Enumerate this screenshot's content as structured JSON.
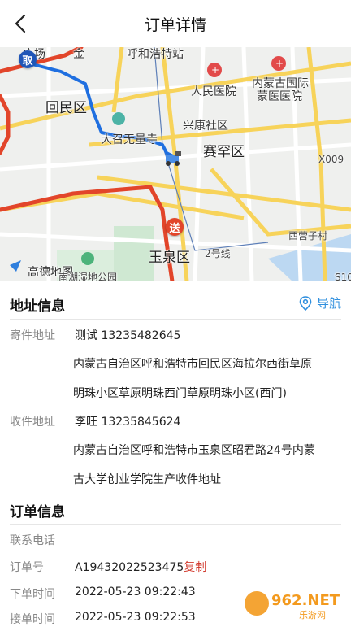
{
  "header": {
    "title": "订单详情"
  },
  "map": {
    "labels": {
      "plaza": "广场",
      "jin": "金",
      "station": "呼和浩特站",
      "hospital1": "人民医院",
      "hospital2a": "内蒙古国际",
      "hospital2b": "蒙医医院",
      "huimin": "回民区",
      "xingkang": "兴康社区",
      "temple": "大召无量寺",
      "saihan": "赛罕区",
      "x009": "X009",
      "xiying": "西营子村",
      "yuquan": "玉泉区",
      "line2": "2号线",
      "gaode": "高德地图",
      "park": "南湖湿地公园",
      "s10": "S10"
    },
    "pickup_badge": "取",
    "delivery_badge": "送",
    "route_color": "#1f6fe0",
    "road_red": "#e2452a"
  },
  "address_section": {
    "title": "地址信息",
    "nav_label": "导航",
    "sender_label": "寄件地址",
    "sender_contact": "测试 13235482645",
    "sender_address_line1": "内蒙古自治区呼和浩特市回民区海拉尔西街草原",
    "sender_address_line2": "明珠小区草原明珠西门草原明珠小区(西门)",
    "receiver_label": "收件地址",
    "receiver_contact": "李旺 13235845624",
    "receiver_address_line1": "内蒙古自治区呼和浩特市玉泉区昭君路24号内蒙",
    "receiver_address_line2": "古大学创业学院生产收件地址"
  },
  "order_section": {
    "title": "订单信息",
    "phone_label": "联系电话",
    "phone_value": "",
    "order_no_label": "订单号",
    "order_no_value": "A19432022523475",
    "copy_label": "复制",
    "order_time_label": "下单时间",
    "order_time_value": "2022-05-23 09:22:43",
    "accept_time_label": "接单时间",
    "accept_time_value": "2022-05-23 09:22:53"
  },
  "watermark": {
    "text": "962.NET",
    "sub": "乐游网"
  }
}
